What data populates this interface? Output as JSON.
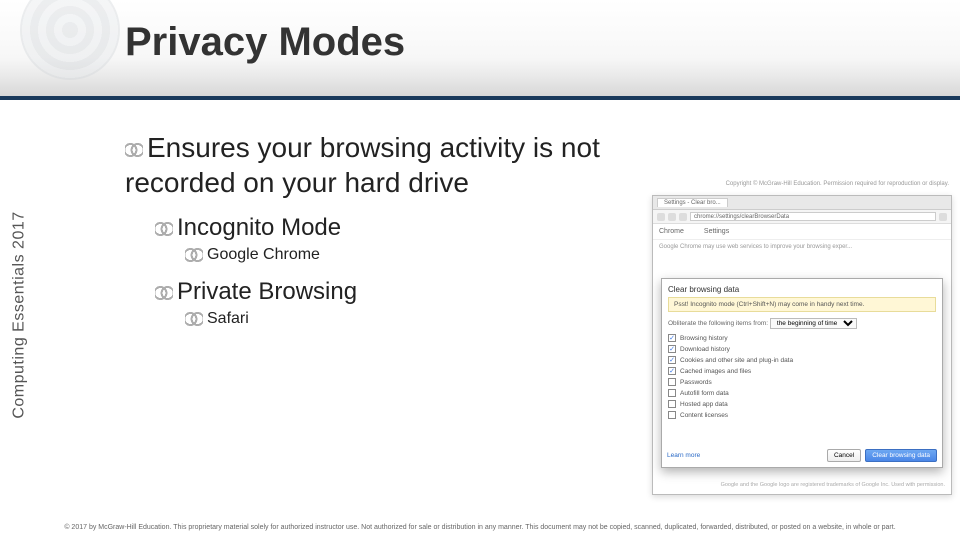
{
  "header": {
    "title": "Privacy Modes"
  },
  "sidebar": {
    "label": "Computing Essentials 2017"
  },
  "content": {
    "bullet1": "Ensures your browsing activity is not recorded on your hard drive",
    "bullet2a": "Incognito Mode",
    "bullet3a": "Google Chrome",
    "bullet2b": "Private Browsing",
    "bullet3b": "Safari"
  },
  "browser": {
    "copyright_top": "Copyright © McGraw-Hill Education. Permission required for reproduction or display.",
    "tab_label": "Settings - Clear bro...",
    "url": "chrome://settings/clearBrowserData",
    "nav_left": "Chrome",
    "nav_right": "Settings",
    "hint_text": "Google Chrome may use web services to improve your browsing exper...",
    "dialog": {
      "title": "Clear browsing data",
      "psst": "Psst! Incognito mode (Ctrl+Shift+N) may come in handy next time.",
      "obliterate_label": "Obliterate the following items from:",
      "obliterate_select": "the beginning of time",
      "checkboxes": [
        {
          "label": "Browsing history",
          "checked": true
        },
        {
          "label": "Download history",
          "checked": true
        },
        {
          "label": "Cookies and other site and plug-in data",
          "checked": true
        },
        {
          "label": "Cached images and files",
          "checked": true
        },
        {
          "label": "Passwords",
          "checked": false
        },
        {
          "label": "Autofill form data",
          "checked": false
        },
        {
          "label": "Hosted app data",
          "checked": false
        },
        {
          "label": "Content licenses",
          "checked": false
        }
      ],
      "learn_more": "Learn more",
      "cancel": "Cancel",
      "clear": "Clear browsing data"
    },
    "footnote": "Google and the Google logo are registered trademarks of Google Inc. Used with permission."
  },
  "footer": {
    "text": "© 2017 by McGraw-Hill Education. This proprietary material solely for authorized instructor use. Not authorized for sale or distribution in any manner. This document may not be copied, scanned, duplicated, forwarded, distributed, or posted on a website, in whole or part."
  }
}
